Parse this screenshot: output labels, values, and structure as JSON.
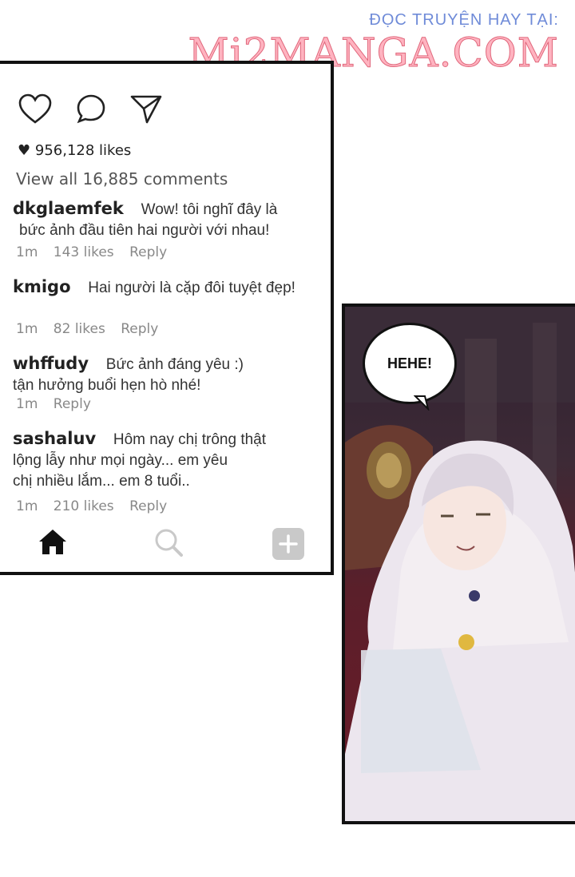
{
  "watermark": {
    "top": "ĐỌC TRUYỆN HAY TẠI:",
    "main": "Mi2MANGA.COM"
  },
  "post": {
    "likes": "956,128 likes",
    "view_all": "View all 16,885 comments",
    "comments": [
      {
        "user": "dkglaemfek",
        "lines": [
          "Wow! tôi nghĩ đây là",
          "bức ảnh đầu tiên hai người với nhau!"
        ],
        "time": "1m",
        "likes": "143 likes",
        "reply": "Reply"
      },
      {
        "user": "kmigo",
        "lines": [
          "Hai người là cặp đôi tuyệt đẹp!"
        ],
        "time": "1m",
        "likes": "82 likes",
        "reply": "Reply"
      },
      {
        "user": "whffudy",
        "lines": [
          "Bức ảnh đáng yêu :)",
          "tận hưởng buổi hẹn hò nhé!"
        ],
        "time": "1m",
        "likes": "",
        "reply": "Reply"
      },
      {
        "user": "sashaluv",
        "lines": [
          "Hôm nay chị trông thật",
          "lộng lẫy như mọi ngày... em yêu",
          "chị nhiều lắm... em 8 tuổi.."
        ],
        "time": "1m",
        "likes": "210 likes",
        "reply": "Reply"
      }
    ]
  },
  "nav": {
    "icons": [
      "home-icon",
      "search-icon",
      "add-icon"
    ]
  },
  "panel": {
    "speech": "HEHE!"
  },
  "colors": {
    "watermark_blue": "#6f8bd8",
    "watermark_pink": "#ffb3c0",
    "panel_red": "#6d1a28"
  }
}
